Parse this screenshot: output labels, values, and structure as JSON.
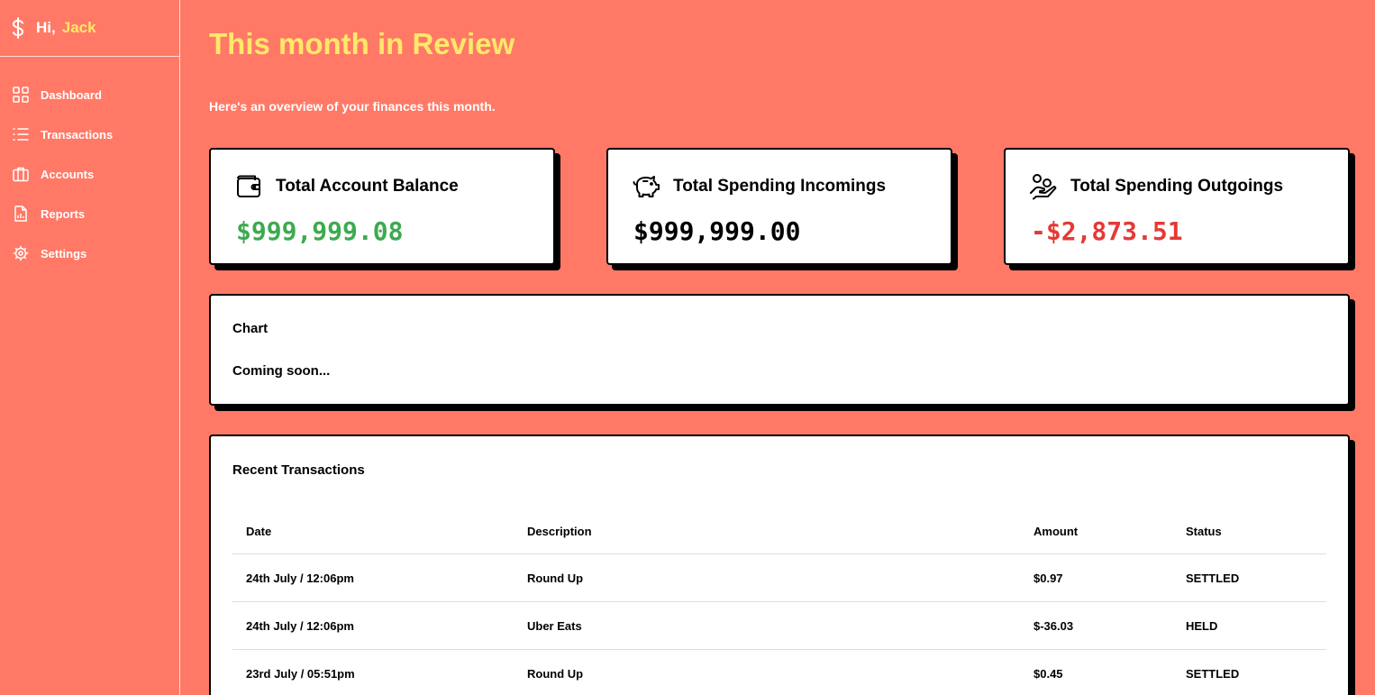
{
  "sidebar": {
    "greeting": "Hi,",
    "user_name": "Jack",
    "items": [
      {
        "label": "Dashboard",
        "icon": "grid-icon"
      },
      {
        "label": "Transactions",
        "icon": "list-icon"
      },
      {
        "label": "Accounts",
        "icon": "briefcase-icon"
      },
      {
        "label": "Reports",
        "icon": "report-icon"
      },
      {
        "label": "Settings",
        "icon": "gear-icon"
      }
    ]
  },
  "header": {
    "title": "This month in Review",
    "subtitle": "Here's an overview of your finances this month."
  },
  "stats": [
    {
      "title": "Total Account Balance",
      "value": "$999,999.08",
      "icon": "wallet-icon",
      "color": "#3DAA4F"
    },
    {
      "title": "Total Spending Incomings",
      "value": "$999,999.00",
      "icon": "piggy-bank-icon",
      "color": "#000000"
    },
    {
      "title": "Total Spending Outgoings",
      "value": "-$2,873.51",
      "icon": "hand-coins-icon",
      "color": "#E53935"
    }
  ],
  "chart": {
    "title": "Chart",
    "message": "Coming soon..."
  },
  "transactions": {
    "title": "Recent Transactions",
    "columns": [
      "Date",
      "Description",
      "Amount",
      "Status"
    ],
    "rows": [
      {
        "date": "24th July / 12:06pm",
        "description": "Round Up",
        "amount": "$0.97",
        "status": "SETTLED"
      },
      {
        "date": "24th July / 12:06pm",
        "description": "Uber Eats",
        "amount": "$-36.03",
        "status": "HELD"
      },
      {
        "date": "23rd July / 05:51pm",
        "description": "Round Up",
        "amount": "$0.45",
        "status": "SETTLED"
      }
    ]
  },
  "colors": {
    "background": "#FF7966",
    "accent": "#FFE86B"
  }
}
